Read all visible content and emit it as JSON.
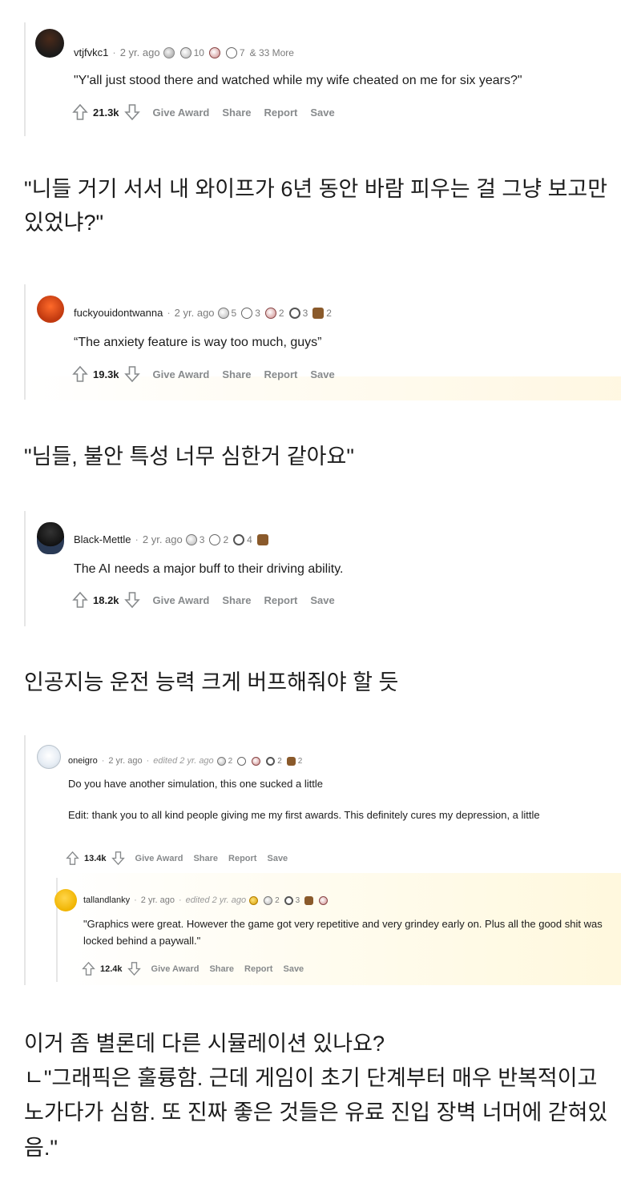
{
  "comments": [
    {
      "username": "vtjfvkc1",
      "time": "2 yr. ago",
      "awards": [
        {
          "icon": "silver-award-icon",
          "count": ""
        },
        {
          "icon": "helpful-award-icon",
          "count": "10"
        },
        {
          "icon": "face-award-icon",
          "count": ""
        },
        {
          "icon": "eye-award-icon",
          "count": "7"
        }
      ],
      "more_awards": "& 33 More",
      "text": "\"Y'all just stood there and watched while my wife cheated on me for six years?\"",
      "votes": "21.3k",
      "actions": {
        "give_award": "Give Award",
        "share": "Share",
        "report": "Report",
        "save": "Save"
      },
      "translation": "\"니들 거기 서서 내 와이프가 6년 동안 바람 피우는 걸 그냥 보고만 있었냐?\""
    },
    {
      "username": "fuckyouidontwanna",
      "time": "2 yr. ago",
      "awards": [
        {
          "icon": "helpful-award-icon",
          "count": "5"
        },
        {
          "icon": "eye-award-icon",
          "count": "3"
        },
        {
          "icon": "swirl-award-icon",
          "count": "2"
        },
        {
          "icon": "coin-award-icon",
          "count": "3"
        },
        {
          "icon": "wholesome-award-icon",
          "count": "2"
        }
      ],
      "text": "“The anxiety feature is way too much, guys”",
      "votes": "19.3k",
      "actions": {
        "give_award": "Give Award",
        "share": "Share",
        "report": "Report",
        "save": "Save"
      },
      "translation": "\"님들, 불안 특성 너무 심한거 같아요\""
    },
    {
      "username": "Black-Mettle",
      "time": "2 yr. ago",
      "awards": [
        {
          "icon": "helpful-award-icon",
          "count": "3"
        },
        {
          "icon": "eye-award-icon",
          "count": "2"
        },
        {
          "icon": "coin-award-icon",
          "count": "4"
        },
        {
          "icon": "wholesome-award-icon",
          "count": ""
        }
      ],
      "text": "The AI needs a major buff to their driving ability.",
      "votes": "18.2k",
      "actions": {
        "give_award": "Give Award",
        "share": "Share",
        "report": "Report",
        "save": "Save"
      },
      "translation": "인공지능 운전 능력 크게 버프해줘야 할 듯"
    },
    {
      "username": "oneigro",
      "time": "2 yr. ago",
      "edited": "edited 2 yr. ago",
      "awards": [
        {
          "icon": "helpful-award-icon",
          "count": "2"
        },
        {
          "icon": "eye-award-icon",
          "count": ""
        },
        {
          "icon": "swirl-award-icon",
          "count": ""
        },
        {
          "icon": "coin-award-icon",
          "count": "2"
        },
        {
          "icon": "wholesome-award-icon",
          "count": "2"
        }
      ],
      "text": "Do you have another simulation, this one sucked a little",
      "edit_text": "Edit: thank you to all kind people giving me my first awards. This definitely cures my depression, a little",
      "votes": "13.4k",
      "actions": {
        "give_award": "Give Award",
        "share": "Share",
        "report": "Report",
        "save": "Save"
      },
      "reply": {
        "username": "tallandlanky",
        "time": "2 yr. ago",
        "edited": "edited 2 yr. ago",
        "awards": [
          {
            "icon": "gold-award-icon",
            "count": ""
          },
          {
            "icon": "helpful-award-icon",
            "count": "2"
          },
          {
            "icon": "coin-award-icon",
            "count": "3"
          },
          {
            "icon": "wholesome-award-icon",
            "count": ""
          },
          {
            "icon": "face-award-icon",
            "count": ""
          }
        ],
        "text": "\"Graphics were great. However the game got very repetitive and very grindey early on. Plus all the good shit was locked behind a paywall.\"",
        "votes": "12.4k",
        "actions": {
          "give_award": "Give Award",
          "share": "Share",
          "report": "Report",
          "save": "Save"
        }
      },
      "translation_lines": [
        "이거 좀 별론데 다른 시뮬레이션 있나요?",
        "ㄴ\"그래픽은 훌륭함. 근데 게임이 초기 단계부터 매우 반복적이고 노가다가 심함. 또 진짜 좋은 것들은 유료 진입 장벽 너머에 갇혀있음.\""
      ]
    }
  ]
}
